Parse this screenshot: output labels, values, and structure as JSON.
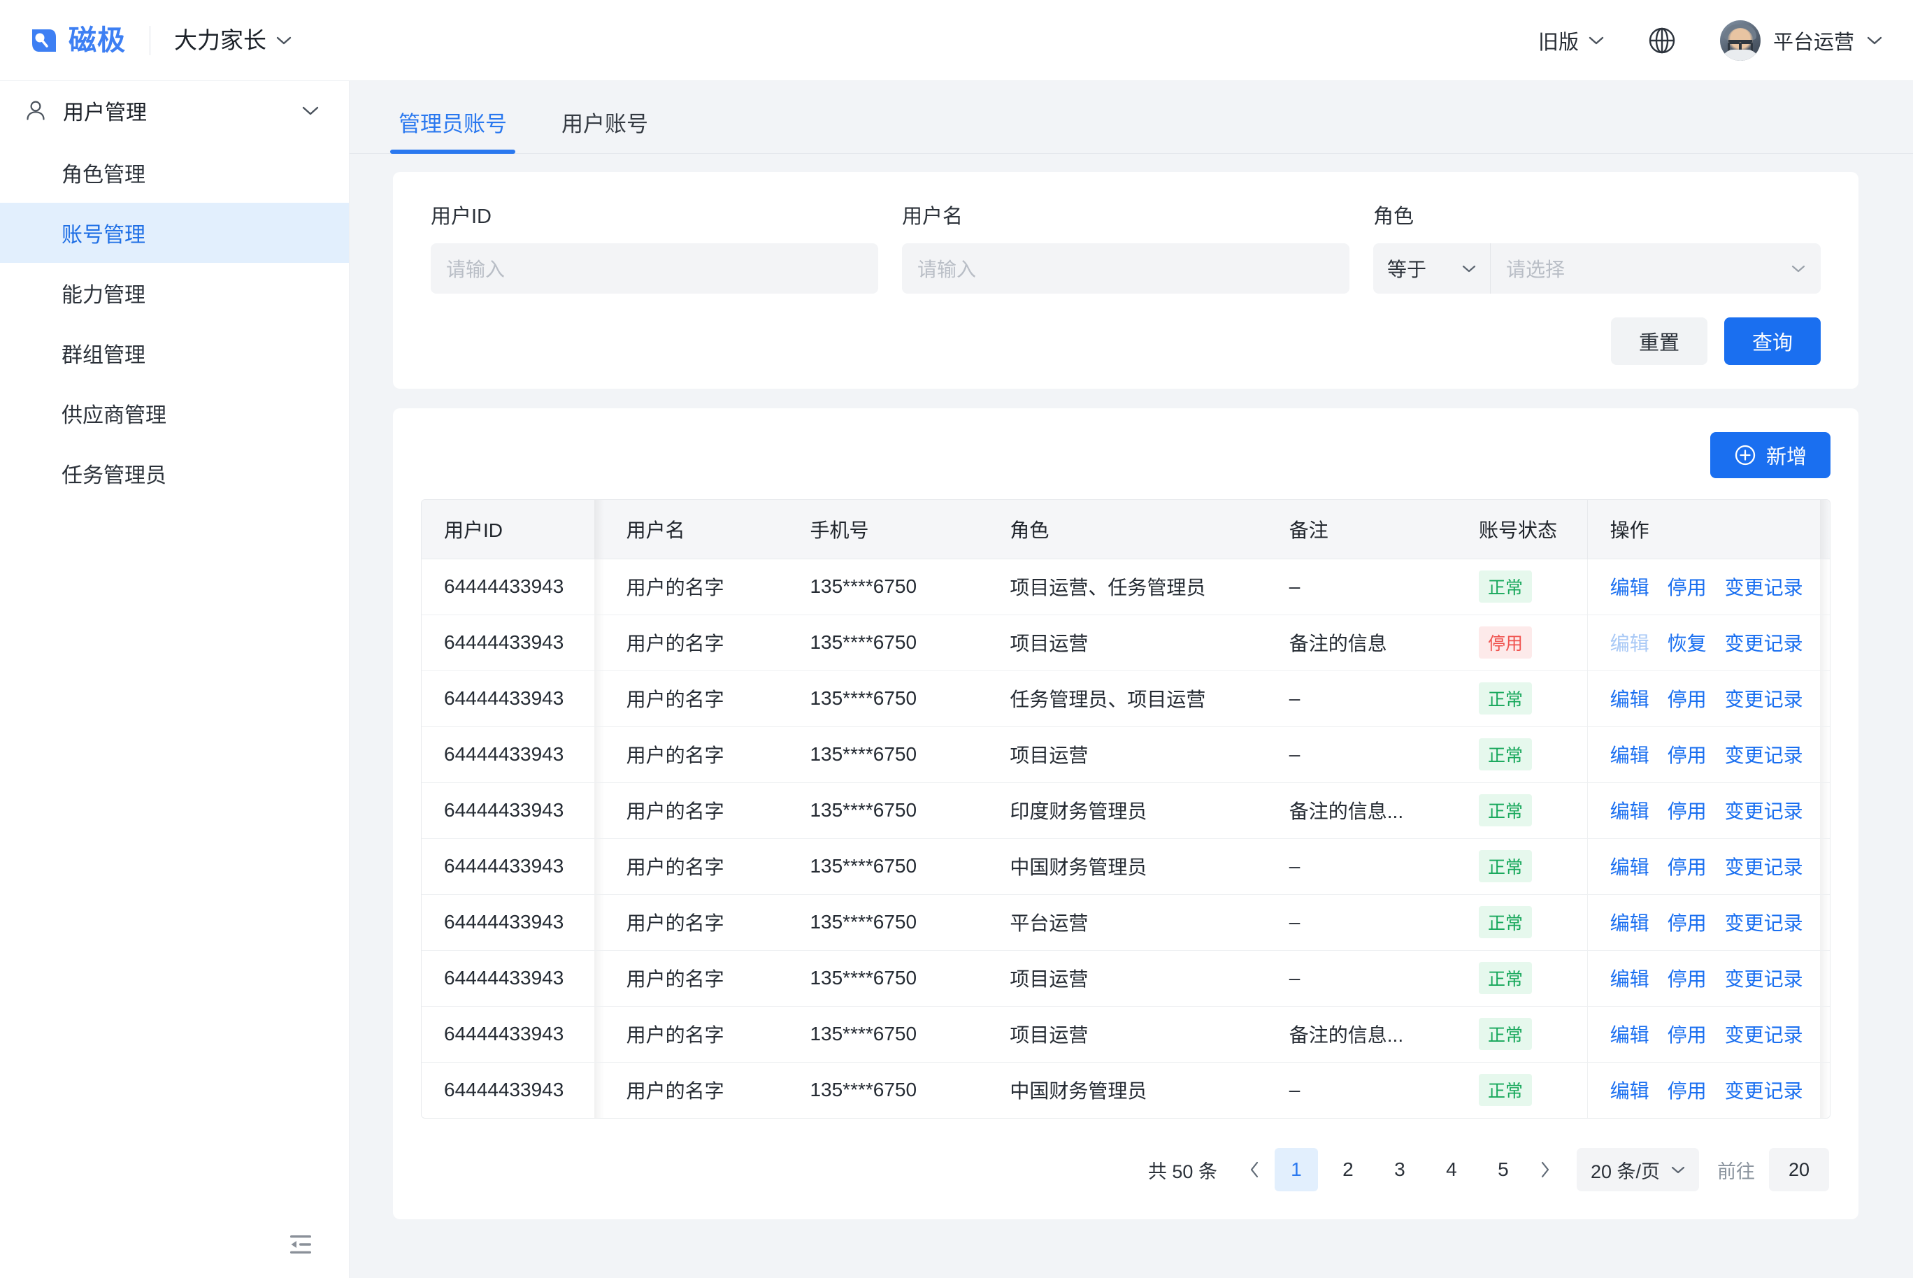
{
  "header": {
    "brand_name": "磁极",
    "brand_color": "#3d7ff3",
    "workspace": "大力家长",
    "version_switch": "旧版",
    "user_name": "平台运营",
    "icons": {
      "globe": "globe-icon",
      "chevron": "chevron-down-icon"
    }
  },
  "sidebar": {
    "group_label": "用户管理",
    "items": [
      {
        "label": "角色管理",
        "active": false
      },
      {
        "label": "账号管理",
        "active": true
      },
      {
        "label": "能力管理",
        "active": false
      },
      {
        "label": "群组管理",
        "active": false
      },
      {
        "label": "供应商管理",
        "active": false
      },
      {
        "label": "任务管理员",
        "active": false
      }
    ],
    "collapse_icon": "menu-fold-icon",
    "active_color": "#1f6fe5",
    "active_bg": "#e2effd"
  },
  "tabs": [
    {
      "label": "管理员账号",
      "active": true
    },
    {
      "label": "用户账号",
      "active": false
    }
  ],
  "filters": {
    "user_id": {
      "label": "用户ID",
      "value": "",
      "placeholder": "请输入"
    },
    "user_name": {
      "label": "用户名",
      "value": "",
      "placeholder": "请输入"
    },
    "role": {
      "label": "角色",
      "operator": "等于",
      "value": "",
      "placeholder": "请选择"
    },
    "reset_label": "重置",
    "search_label": "查询"
  },
  "toolbar": {
    "add_label": "新增",
    "add_icon": "plus-circle-icon"
  },
  "table": {
    "columns": [
      "用户ID",
      "用户名",
      "手机号",
      "角色",
      "备注",
      "账号状态",
      "操作"
    ],
    "rows": [
      {
        "id": "64444433943",
        "name": "用户的名字",
        "phone": "135****6750",
        "role": "项目运营、任务管理员",
        "note": "–",
        "status": "正常",
        "status_type": "ok",
        "ops": [
          {
            "label": "编辑",
            "disabled": false
          },
          {
            "label": "停用",
            "disabled": false
          },
          {
            "label": "变更记录",
            "disabled": false
          }
        ]
      },
      {
        "id": "64444433943",
        "name": "用户的名字",
        "phone": "135****6750",
        "role": "项目运营",
        "note": "备注的信息",
        "status": "停用",
        "status_type": "off",
        "ops": [
          {
            "label": "编辑",
            "disabled": true
          },
          {
            "label": "恢复",
            "disabled": false
          },
          {
            "label": "变更记录",
            "disabled": false
          }
        ]
      },
      {
        "id": "64444433943",
        "name": "用户的名字",
        "phone": "135****6750",
        "role": "任务管理员、项目运营",
        "note": "–",
        "status": "正常",
        "status_type": "ok",
        "ops": [
          {
            "label": "编辑",
            "disabled": false
          },
          {
            "label": "停用",
            "disabled": false
          },
          {
            "label": "变更记录",
            "disabled": false
          }
        ]
      },
      {
        "id": "64444433943",
        "name": "用户的名字",
        "phone": "135****6750",
        "role": "项目运营",
        "note": "–",
        "status": "正常",
        "status_type": "ok",
        "ops": [
          {
            "label": "编辑",
            "disabled": false
          },
          {
            "label": "停用",
            "disabled": false
          },
          {
            "label": "变更记录",
            "disabled": false
          }
        ]
      },
      {
        "id": "64444433943",
        "name": "用户的名字",
        "phone": "135****6750",
        "role": "印度财务管理员",
        "note": "备注的信息...",
        "status": "正常",
        "status_type": "ok",
        "ops": [
          {
            "label": "编辑",
            "disabled": false
          },
          {
            "label": "停用",
            "disabled": false
          },
          {
            "label": "变更记录",
            "disabled": false
          }
        ]
      },
      {
        "id": "64444433943",
        "name": "用户的名字",
        "phone": "135****6750",
        "role": "中国财务管理员",
        "note": "–",
        "status": "正常",
        "status_type": "ok",
        "ops": [
          {
            "label": "编辑",
            "disabled": false
          },
          {
            "label": "停用",
            "disabled": false
          },
          {
            "label": "变更记录",
            "disabled": false
          }
        ]
      },
      {
        "id": "64444433943",
        "name": "用户的名字",
        "phone": "135****6750",
        "role": "平台运营",
        "note": "–",
        "status": "正常",
        "status_type": "ok",
        "ops": [
          {
            "label": "编辑",
            "disabled": false
          },
          {
            "label": "停用",
            "disabled": false
          },
          {
            "label": "变更记录",
            "disabled": false
          }
        ]
      },
      {
        "id": "64444433943",
        "name": "用户的名字",
        "phone": "135****6750",
        "role": "项目运营",
        "note": "–",
        "status": "正常",
        "status_type": "ok",
        "ops": [
          {
            "label": "编辑",
            "disabled": false
          },
          {
            "label": "停用",
            "disabled": false
          },
          {
            "label": "变更记录",
            "disabled": false
          }
        ]
      },
      {
        "id": "64444433943",
        "name": "用户的名字",
        "phone": "135****6750",
        "role": "项目运营",
        "note": "备注的信息...",
        "status": "正常",
        "status_type": "ok",
        "ops": [
          {
            "label": "编辑",
            "disabled": false
          },
          {
            "label": "停用",
            "disabled": false
          },
          {
            "label": "变更记录",
            "disabled": false
          }
        ]
      },
      {
        "id": "64444433943",
        "name": "用户的名字",
        "phone": "135****6750",
        "role": "中国财务管理员",
        "note": "–",
        "status": "正常",
        "status_type": "ok",
        "ops": [
          {
            "label": "编辑",
            "disabled": false
          },
          {
            "label": "停用",
            "disabled": false
          },
          {
            "label": "变更记录",
            "disabled": false
          }
        ]
      }
    ]
  },
  "pagination": {
    "total_label": "共 50 条",
    "prev_icon": "chevron-left-icon",
    "next_icon": "chevron-right-icon",
    "pages": [
      "1",
      "2",
      "3",
      "4",
      "5"
    ],
    "current_page": "1",
    "page_size": "20 条/页",
    "jump_label": "前往",
    "jump_value": "20"
  },
  "colors": {
    "primary": "#1a6ff0",
    "success": "#18a85c",
    "danger": "#f0534f"
  }
}
